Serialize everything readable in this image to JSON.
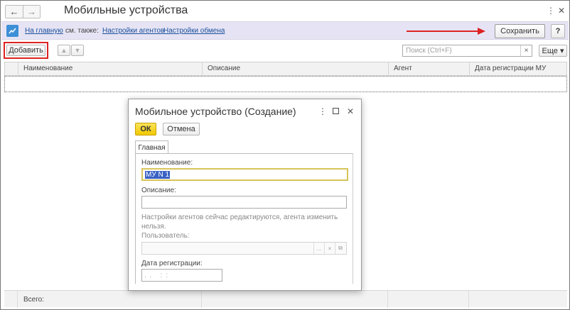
{
  "window": {
    "title": "Мобильные устройства",
    "nav_back": "←",
    "nav_forward": "→",
    "more_icon": "⋮",
    "close_icon": "✕"
  },
  "cmdbar": {
    "home_link": "На главную",
    "see_also_label": "см. также:",
    "link_agents": "Настройки агентов",
    "link_exchange": "Настройки обмена",
    "save_label": "Сохранить",
    "help_label": "?"
  },
  "toolbar": {
    "add_label": "Добавить",
    "move_up": "▲",
    "move_down": "▼",
    "search_placeholder": "Поиск (Ctrl+F)",
    "search_clear": "×",
    "more_label": "Еще ▾"
  },
  "table": {
    "columns": [
      "Наименование",
      "Описание",
      "Агент",
      "Дата регистрации МУ"
    ],
    "footer_total": "Всего:"
  },
  "dialog": {
    "title": "Мобильное устройство (Создание)",
    "ok_label": "ОК",
    "cancel_label": "Отмена",
    "tab_main": "Главная",
    "name_label": "Наименование:",
    "name_value": "МУ N 1",
    "description_label": "Описание:",
    "description_value": "",
    "agents_note": "Настройки агентов сейчас редактируются, агента изменить нельзя.",
    "user_label": "Пользователь:",
    "user_value": "",
    "user_select_btn": "...",
    "user_clear_btn": "×",
    "user_open_btn": "⧉",
    "regdate_label": "Дата регистрации:",
    "regdate_mask": ". .   : :"
  },
  "colors": {
    "accent_red": "#dd2222",
    "command_bar": "#e6e4f4",
    "ok_yellow": "#f0c700",
    "link_blue": "#1a4f9c"
  }
}
